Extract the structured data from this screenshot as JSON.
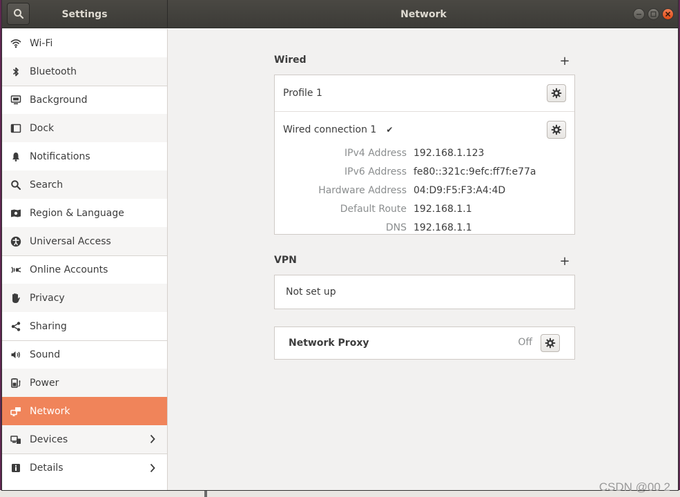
{
  "window": {
    "sidebar_title": "Settings",
    "panel_title": "Network"
  },
  "sidebar": {
    "items": [
      {
        "label": "Wi-Fi",
        "icon": "wifi-icon"
      },
      {
        "label": "Bluetooth",
        "icon": "bluetooth-icon"
      },
      {
        "label": "Background",
        "icon": "background-icon"
      },
      {
        "label": "Dock",
        "icon": "dock-icon"
      },
      {
        "label": "Notifications",
        "icon": "bell-icon"
      },
      {
        "label": "Search",
        "icon": "search-icon"
      },
      {
        "label": "Region & Language",
        "icon": "region-icon"
      },
      {
        "label": "Universal Access",
        "icon": "accessibility-icon"
      },
      {
        "label": "Online Accounts",
        "icon": "online-accounts-icon"
      },
      {
        "label": "Privacy",
        "icon": "hand-icon"
      },
      {
        "label": "Sharing",
        "icon": "share-icon"
      },
      {
        "label": "Sound",
        "icon": "speaker-icon"
      },
      {
        "label": "Power",
        "icon": "power-icon"
      },
      {
        "label": "Network",
        "icon": "network-icon",
        "active": true
      },
      {
        "label": "Devices",
        "icon": "devices-icon"
      },
      {
        "label": "Details",
        "icon": "info-icon"
      }
    ]
  },
  "wired": {
    "title": "Wired",
    "add_label": "+",
    "profile": "Profile 1",
    "connection_name": "Wired connection 1",
    "connection_check": "✔",
    "details": [
      {
        "label": "IPv4 Address",
        "value": "192.168.1.123"
      },
      {
        "label": "IPv6 Address",
        "value": "fe80::321c:9efc:ff7f:e77a"
      },
      {
        "label": "Hardware Address",
        "value": "04:D9:F5:F3:A4:4D"
      },
      {
        "label": "Default Route",
        "value": "192.168.1.1"
      },
      {
        "label": "DNS",
        "value": "192.168.1.1"
      }
    ]
  },
  "vpn": {
    "title": "VPN",
    "add_label": "+",
    "status": "Not set up"
  },
  "proxy": {
    "title": "Network Proxy",
    "status": "Off"
  },
  "watermark": "CSDN @00 2",
  "colors": {
    "accent": "#f0845a",
    "header": "#3c3b37",
    "close_button": "#e9581f"
  }
}
